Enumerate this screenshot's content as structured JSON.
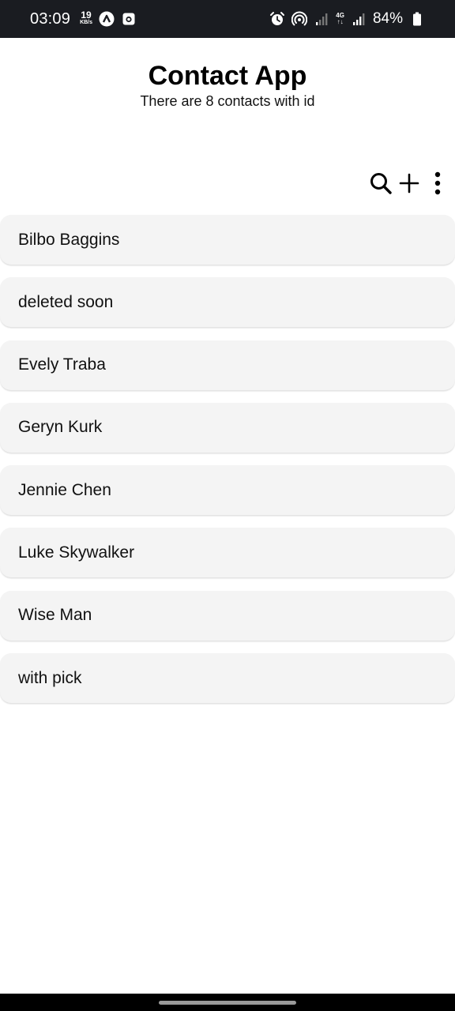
{
  "status_bar": {
    "time": "03:09",
    "net_speed_value": "19",
    "net_speed_unit": "KB/s",
    "network_type_top": "4G",
    "network_type_bottom": "↑↓",
    "battery": "84%"
  },
  "header": {
    "title": "Contact App",
    "subtitle": "There are 8 contacts with id"
  },
  "toolbar": {
    "icons": [
      "search-icon",
      "plus-icon",
      "more-vert-icon"
    ]
  },
  "contacts": [
    {
      "name": "Bilbo Baggins"
    },
    {
      "name": "deleted soon"
    },
    {
      "name": "Evely Traba"
    },
    {
      "name": "Geryn Kurk"
    },
    {
      "name": "Jennie Chen"
    },
    {
      "name": "Luke Skywalker"
    },
    {
      "name": "Wise Man"
    },
    {
      "name": "with pick"
    }
  ],
  "colors": {
    "status_bar_bg": "#1a1c21",
    "item_bg": "#f4f4f4",
    "text": "#111111"
  }
}
